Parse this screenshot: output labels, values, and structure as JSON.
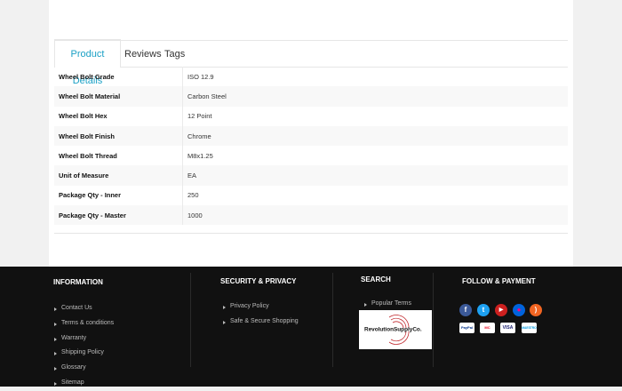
{
  "tabs": [
    {
      "label": "Product Details"
    },
    {
      "label": "Reviews"
    },
    {
      "label": "Tags"
    }
  ],
  "specs": [
    {
      "k": "Wheel Bolt Grade",
      "v": "ISO 12.9"
    },
    {
      "k": "Wheel Bolt Material",
      "v": "Carbon Steel"
    },
    {
      "k": "Wheel Bolt Hex",
      "v": "12 Point"
    },
    {
      "k": "Wheel Bolt Finish",
      "v": "Chrome"
    },
    {
      "k": "Wheel Bolt Thread",
      "v": "M8x1.25"
    },
    {
      "k": "Unit of Measure",
      "v": "EA"
    },
    {
      "k": "Package Qty - Inner",
      "v": "250"
    },
    {
      "k": "Package Qty - Master",
      "v": "1000"
    }
  ],
  "footer": {
    "information": {
      "title": "INFORMATION",
      "links": [
        "Contact Us",
        "Terms & conditions",
        "Warranty",
        "Shipping Policy",
        "Glossary",
        "Sitemap"
      ]
    },
    "security": {
      "title": "SECURITY & PRIVACY",
      "links": [
        "Privacy Policy",
        "Safe & Secure Shopping"
      ]
    },
    "search": {
      "title": "SEARCH",
      "links": [
        "Popular Terms"
      ],
      "logo_text": "RevolutionSupplyCo."
    },
    "follow": {
      "title": "FOLLOW & PAYMENT",
      "social": [
        {
          "icon": "facebook-icon",
          "glyph": "f",
          "color": "#3b5998"
        },
        {
          "icon": "twitter-icon",
          "glyph": "t",
          "color": "#1da1f2"
        },
        {
          "icon": "youtube-icon",
          "glyph": "▶",
          "color": "#cd201f"
        },
        {
          "icon": "flickr-icon",
          "glyph": "●",
          "color": "#0063dc"
        },
        {
          "icon": "rss-icon",
          "glyph": ")",
          "color": "#f26522"
        }
      ],
      "payments": [
        {
          "icon": "paypal-icon",
          "label": "PayPal",
          "color": "#003087"
        },
        {
          "icon": "mastercard-icon",
          "label": "MC",
          "color": "#eb001b"
        },
        {
          "icon": "visa-icon",
          "label": "VISA",
          "color": "#1a1f71"
        },
        {
          "icon": "maestro-icon",
          "label": "MAESTRO",
          "color": "#0099df"
        }
      ]
    }
  }
}
